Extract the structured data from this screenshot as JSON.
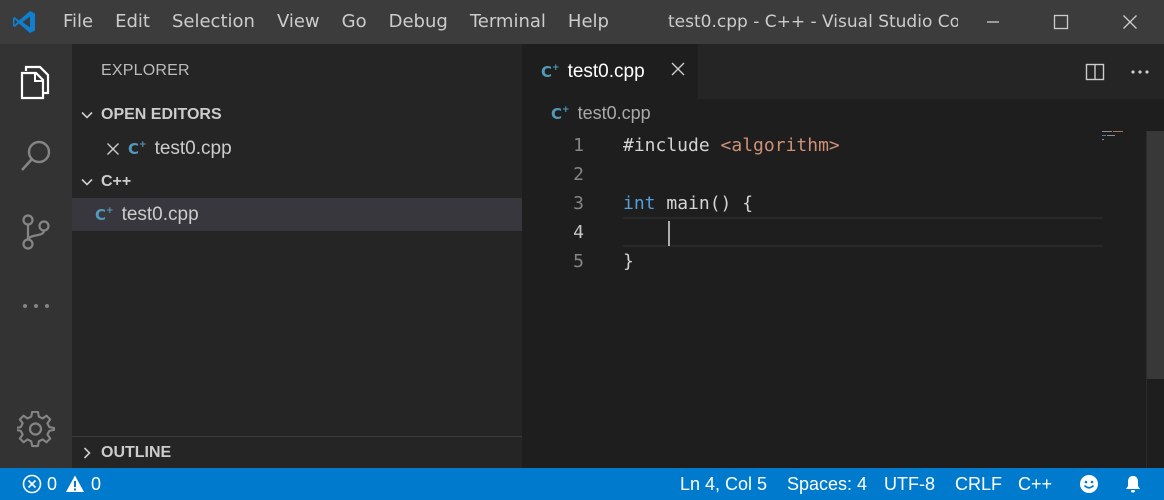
{
  "titlebar": {
    "menu": [
      "File",
      "Edit",
      "Selection",
      "View",
      "Go",
      "Debug",
      "Terminal",
      "Help"
    ],
    "window_title": "test0.cpp - C++ - Visual Studio Co..."
  },
  "activitybar": {
    "icons": [
      "files-icon",
      "search-icon",
      "source-control-icon",
      "more-icon",
      "settings-gear-icon"
    ]
  },
  "sidebar": {
    "title": "EXPLORER",
    "open_editors": {
      "label": "OPEN EDITORS",
      "items": [
        {
          "name": "test0.cpp"
        }
      ]
    },
    "folder": {
      "label": "C++",
      "items": [
        {
          "name": "test0.cpp"
        }
      ]
    },
    "outline_label": "OUTLINE"
  },
  "editor": {
    "tab": {
      "label": "test0.cpp"
    },
    "breadcrumb": "test0.cpp",
    "lines": [
      {
        "number": "1",
        "text": "#include <algorithm>"
      },
      {
        "number": "2",
        "text": ""
      },
      {
        "number": "3",
        "text": "int main() {"
      },
      {
        "number": "4",
        "text": "    "
      },
      {
        "number": "5",
        "text": "}"
      }
    ],
    "current_line": 4
  },
  "statusbar": {
    "errors": "0",
    "warnings": "0",
    "position": "Ln 4, Col 5",
    "spaces": "Spaces: 4",
    "encoding": "UTF-8",
    "eol": "CRLF",
    "language": "C++"
  },
  "colors": {
    "accent": "#007acc",
    "titlebar": "#3c3c3c",
    "activitybar": "#333333",
    "sidebar": "#252526",
    "editor_bg": "#1e1e1e",
    "keyword": "#569cd6",
    "string": "#ce9178"
  }
}
